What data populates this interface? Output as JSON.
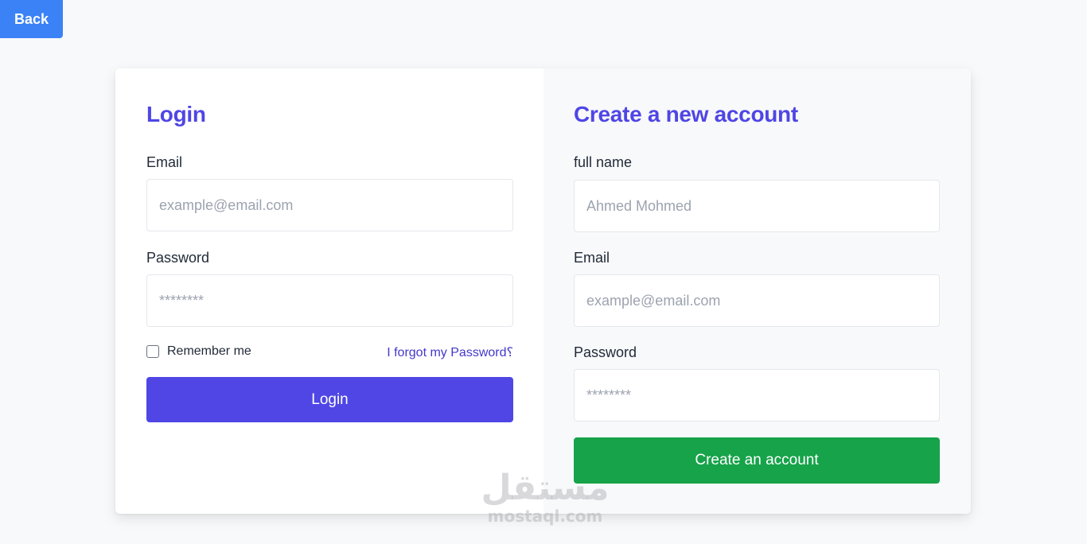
{
  "back_button": {
    "label": "Back"
  },
  "login": {
    "title": "Login",
    "email_label": "Email",
    "email_placeholder": "example@email.com",
    "password_label": "Password",
    "password_placeholder": "********",
    "remember_label": "Remember me",
    "remember_checked": false,
    "forgot_link": "I forgot my Password؟",
    "submit_label": "Login"
  },
  "register": {
    "title": "Create a new account",
    "name_label": "full name",
    "name_placeholder": "Ahmed Mohmed",
    "email_label": "Email",
    "email_placeholder": "example@email.com",
    "password_label": "Password",
    "password_placeholder": "********",
    "submit_label": "Create an account"
  },
  "watermark": {
    "arabic": "مستقل",
    "latin": "mostaql.com"
  },
  "colors": {
    "back_button": "#3b82f6",
    "heading": "#4f46e5",
    "login_button": "#4f46e5",
    "create_button": "#16a34a",
    "link": "#4338ca"
  }
}
